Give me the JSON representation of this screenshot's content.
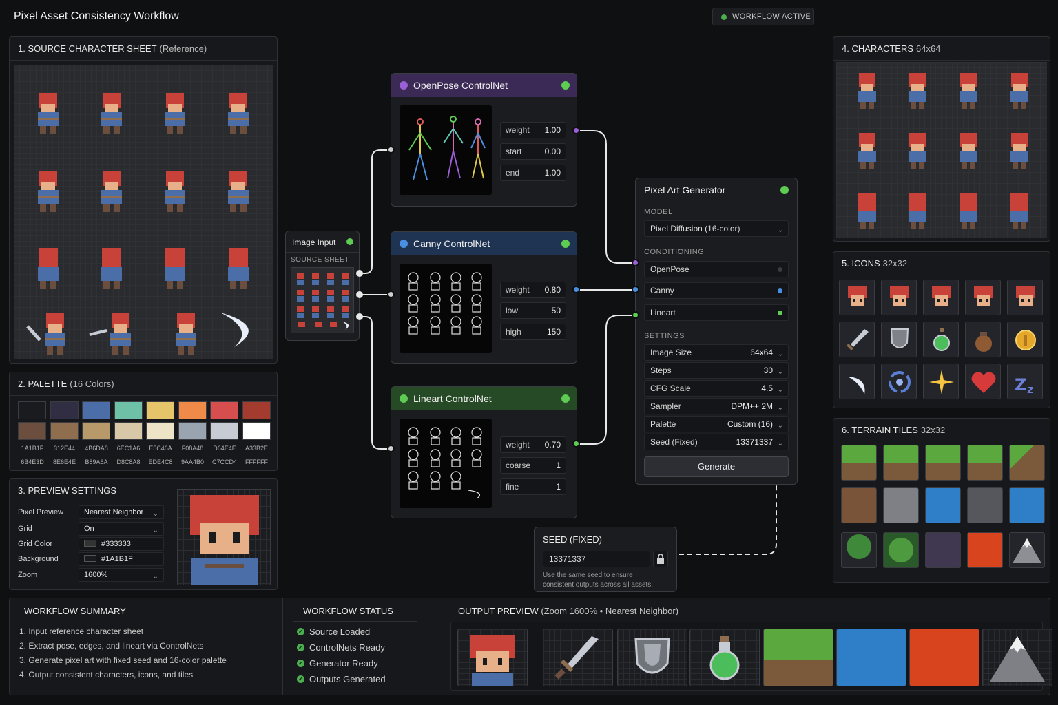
{
  "window": {
    "title": "Pixel Asset Consistency Workflow",
    "status_badge": "WORKFLOW ACTIVE"
  },
  "source_sheet": {
    "title": "1. SOURCE CHARACTER SHEET",
    "subtitle": "(Reference)"
  },
  "palette": {
    "title": "2. PALETTE",
    "subtitle": "(16 Colors)",
    "colors": [
      "#1A1B1F",
      "#312E44",
      "#4B6DA8",
      "#6EC1A6",
      "#E5C46A",
      "#F08A48",
      "#D64E4E",
      "#A33B2E",
      "#6B4E3D",
      "#8E6E4E",
      "#B89A6A",
      "#D8C8A8",
      "#EDE4C8",
      "#9AA4B0",
      "#C7CCD4",
      "#FFFFFF"
    ],
    "labels": [
      "1A1B1F",
      "312E44",
      "4B6DA8",
      "6EC1A6",
      "E5C46A",
      "F08A48",
      "D64E4E",
      "A33B2E",
      "6B4E3D",
      "8E6E4E",
      "B89A6A",
      "D8C8A8",
      "EDE4C8",
      "9AA4B0",
      "C7CCD4",
      "FFFFFF"
    ]
  },
  "preview_settings": {
    "title": "3. PREVIEW SETTINGS",
    "pixel_preview_label": "Pixel Preview",
    "pixel_preview_value": "Nearest Neighbor",
    "grid_label": "Grid",
    "grid_value": "On",
    "grid_color_label": "Grid Color",
    "grid_color_value": "#333333",
    "background_label": "Background",
    "background_value": "#1A1B1F",
    "zoom_label": "Zoom",
    "zoom_value": "1600%"
  },
  "image_input": {
    "title": "Image Input",
    "section": "SOURCE SHEET"
  },
  "openpose": {
    "title": "OpenPose ControlNet",
    "params": [
      {
        "k": "weight",
        "v": "1.00"
      },
      {
        "k": "start",
        "v": "0.00"
      },
      {
        "k": "end",
        "v": "1.00"
      }
    ]
  },
  "canny": {
    "title": "Canny ControlNet",
    "params": [
      {
        "k": "weight",
        "v": "0.80"
      },
      {
        "k": "low",
        "v": "50"
      },
      {
        "k": "high",
        "v": "150"
      }
    ]
  },
  "lineart": {
    "title": "Lineart ControlNet",
    "params": [
      {
        "k": "weight",
        "v": "0.70"
      },
      {
        "k": "coarse",
        "v": "1"
      },
      {
        "k": "fine",
        "v": "1"
      }
    ]
  },
  "generator": {
    "title": "Pixel Art Generator",
    "model_section": "MODEL",
    "model_value": "Pixel Diffusion (16-color)",
    "conditioning_section": "CONDITIONING",
    "conditioning": [
      "OpenPose",
      "Canny",
      "Lineart"
    ],
    "settings_section": "SETTINGS",
    "settings": [
      {
        "k": "Image Size",
        "v": "64x64"
      },
      {
        "k": "Steps",
        "v": "30"
      },
      {
        "k": "CFG Scale",
        "v": "4.5"
      },
      {
        "k": "Sampler",
        "v": "DPM++ 2M"
      },
      {
        "k": "Palette",
        "v": "Custom (16)"
      },
      {
        "k": "Seed (Fixed)",
        "v": "13371337"
      }
    ],
    "generate_label": "Generate"
  },
  "seed": {
    "title": "SEED (FIXED)",
    "value": "13371337",
    "note_line1": "Use the same seed to ensure",
    "note_line2": "consistent outputs across all assets."
  },
  "characters": {
    "title": "4. CHARACTERS",
    "subtitle": "64x64"
  },
  "icons": {
    "title": "5. ICONS",
    "subtitle": "32x32",
    "items": [
      "head",
      "head",
      "head",
      "head",
      "head",
      "sword",
      "shield",
      "potion",
      "bag",
      "coin",
      "crescent",
      "swirl",
      "sparkle",
      "heart",
      "sleep"
    ]
  },
  "terrain": {
    "title": "6. TERRAIN TILES",
    "subtitle": "32x32"
  },
  "summary": {
    "title": "WORKFLOW SUMMARY",
    "steps": [
      "1. Input reference character sheet",
      "2. Extract pose, edges, and lineart via ControlNets",
      "3. Generate pixel art with fixed seed and 16-color palette",
      "4. Output consistent characters, icons, and tiles"
    ]
  },
  "status": {
    "title": "WORKFLOW STATUS",
    "items": [
      "Source Loaded",
      "ControlNets Ready",
      "Generator Ready",
      "Outputs Generated"
    ]
  },
  "output_preview": {
    "title": "OUTPUT PREVIEW",
    "subtitle": "(Zoom 1600% • Nearest Neighbor)",
    "items": [
      "character",
      "sword",
      "shield",
      "potion",
      "grass",
      "water",
      "lava",
      "mountain"
    ]
  },
  "colors": {
    "openpose": "#9b5fd6",
    "canny": "#4a90e2",
    "lineart": "#5ecb52",
    "ready": "#4cae4f"
  }
}
